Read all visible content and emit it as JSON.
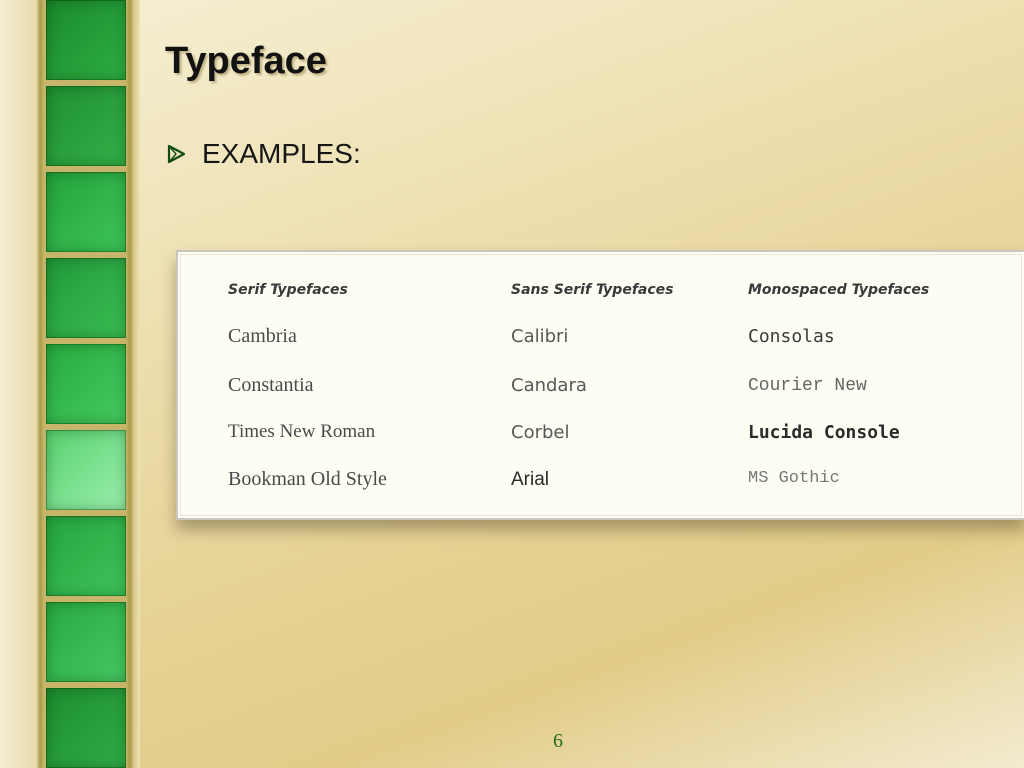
{
  "slide": {
    "title": "Typeface",
    "bullet": "EXAMPLES:",
    "page_number": "6",
    "colors": {
      "tile_dark": "#1e8c2e",
      "tile_light": "#7fe08f",
      "bullet_arrow": "#0f4a0f",
      "page_number": "#2a6a1e"
    }
  },
  "table": {
    "columns": [
      {
        "header": "Serif Typefaces",
        "items": [
          "Cambria",
          "Constantia",
          "Times New Roman",
          "Bookman Old Style"
        ]
      },
      {
        "header": "Sans Serif Typefaces",
        "items": [
          "Calibri",
          "Candara",
          "Corbel",
          "Arial"
        ]
      },
      {
        "header": "Monospaced Typefaces",
        "items": [
          "Consolas",
          "Courier New",
          "Lucida Console",
          "MS Gothic"
        ]
      }
    ]
  }
}
